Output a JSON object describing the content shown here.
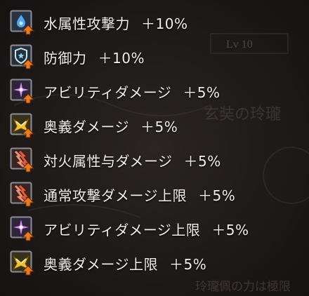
{
  "background": {
    "level_text": "Lv 10",
    "seal_text": "玄奘の玲瓏",
    "footer_text": "玲瓏佩の力は極限"
  },
  "colors": {
    "text": "#f4efe9",
    "icon_frame": "#8a8f99",
    "arrow": "#f07a1a",
    "background": "#1c1918"
  },
  "skills": [
    {
      "icon": "water-element-icon",
      "label": "水属性攻撃力",
      "value": "＋10%"
    },
    {
      "icon": "defense-shield-icon",
      "label": "防御力",
      "value": "＋10%"
    },
    {
      "icon": "ability-damage-icon",
      "label": "アビリティダメージ",
      "value": "＋5%"
    },
    {
      "icon": "ougi-damage-icon",
      "label": "奥義ダメージ",
      "value": "＋5%"
    },
    {
      "icon": "fire-damage-icon",
      "label": "対火属性与ダメージ",
      "value": "＋5%"
    },
    {
      "icon": "normal-attack-cap-icon",
      "label": "通常攻撃ダメージ上限",
      "value": "＋5%"
    },
    {
      "icon": "ability-damage-cap-icon",
      "label": "アビリティダメージ上限",
      "value": "＋5%"
    },
    {
      "icon": "ougi-damage-cap-icon",
      "label": "奥義ダメージ上限",
      "value": "＋5%"
    }
  ]
}
